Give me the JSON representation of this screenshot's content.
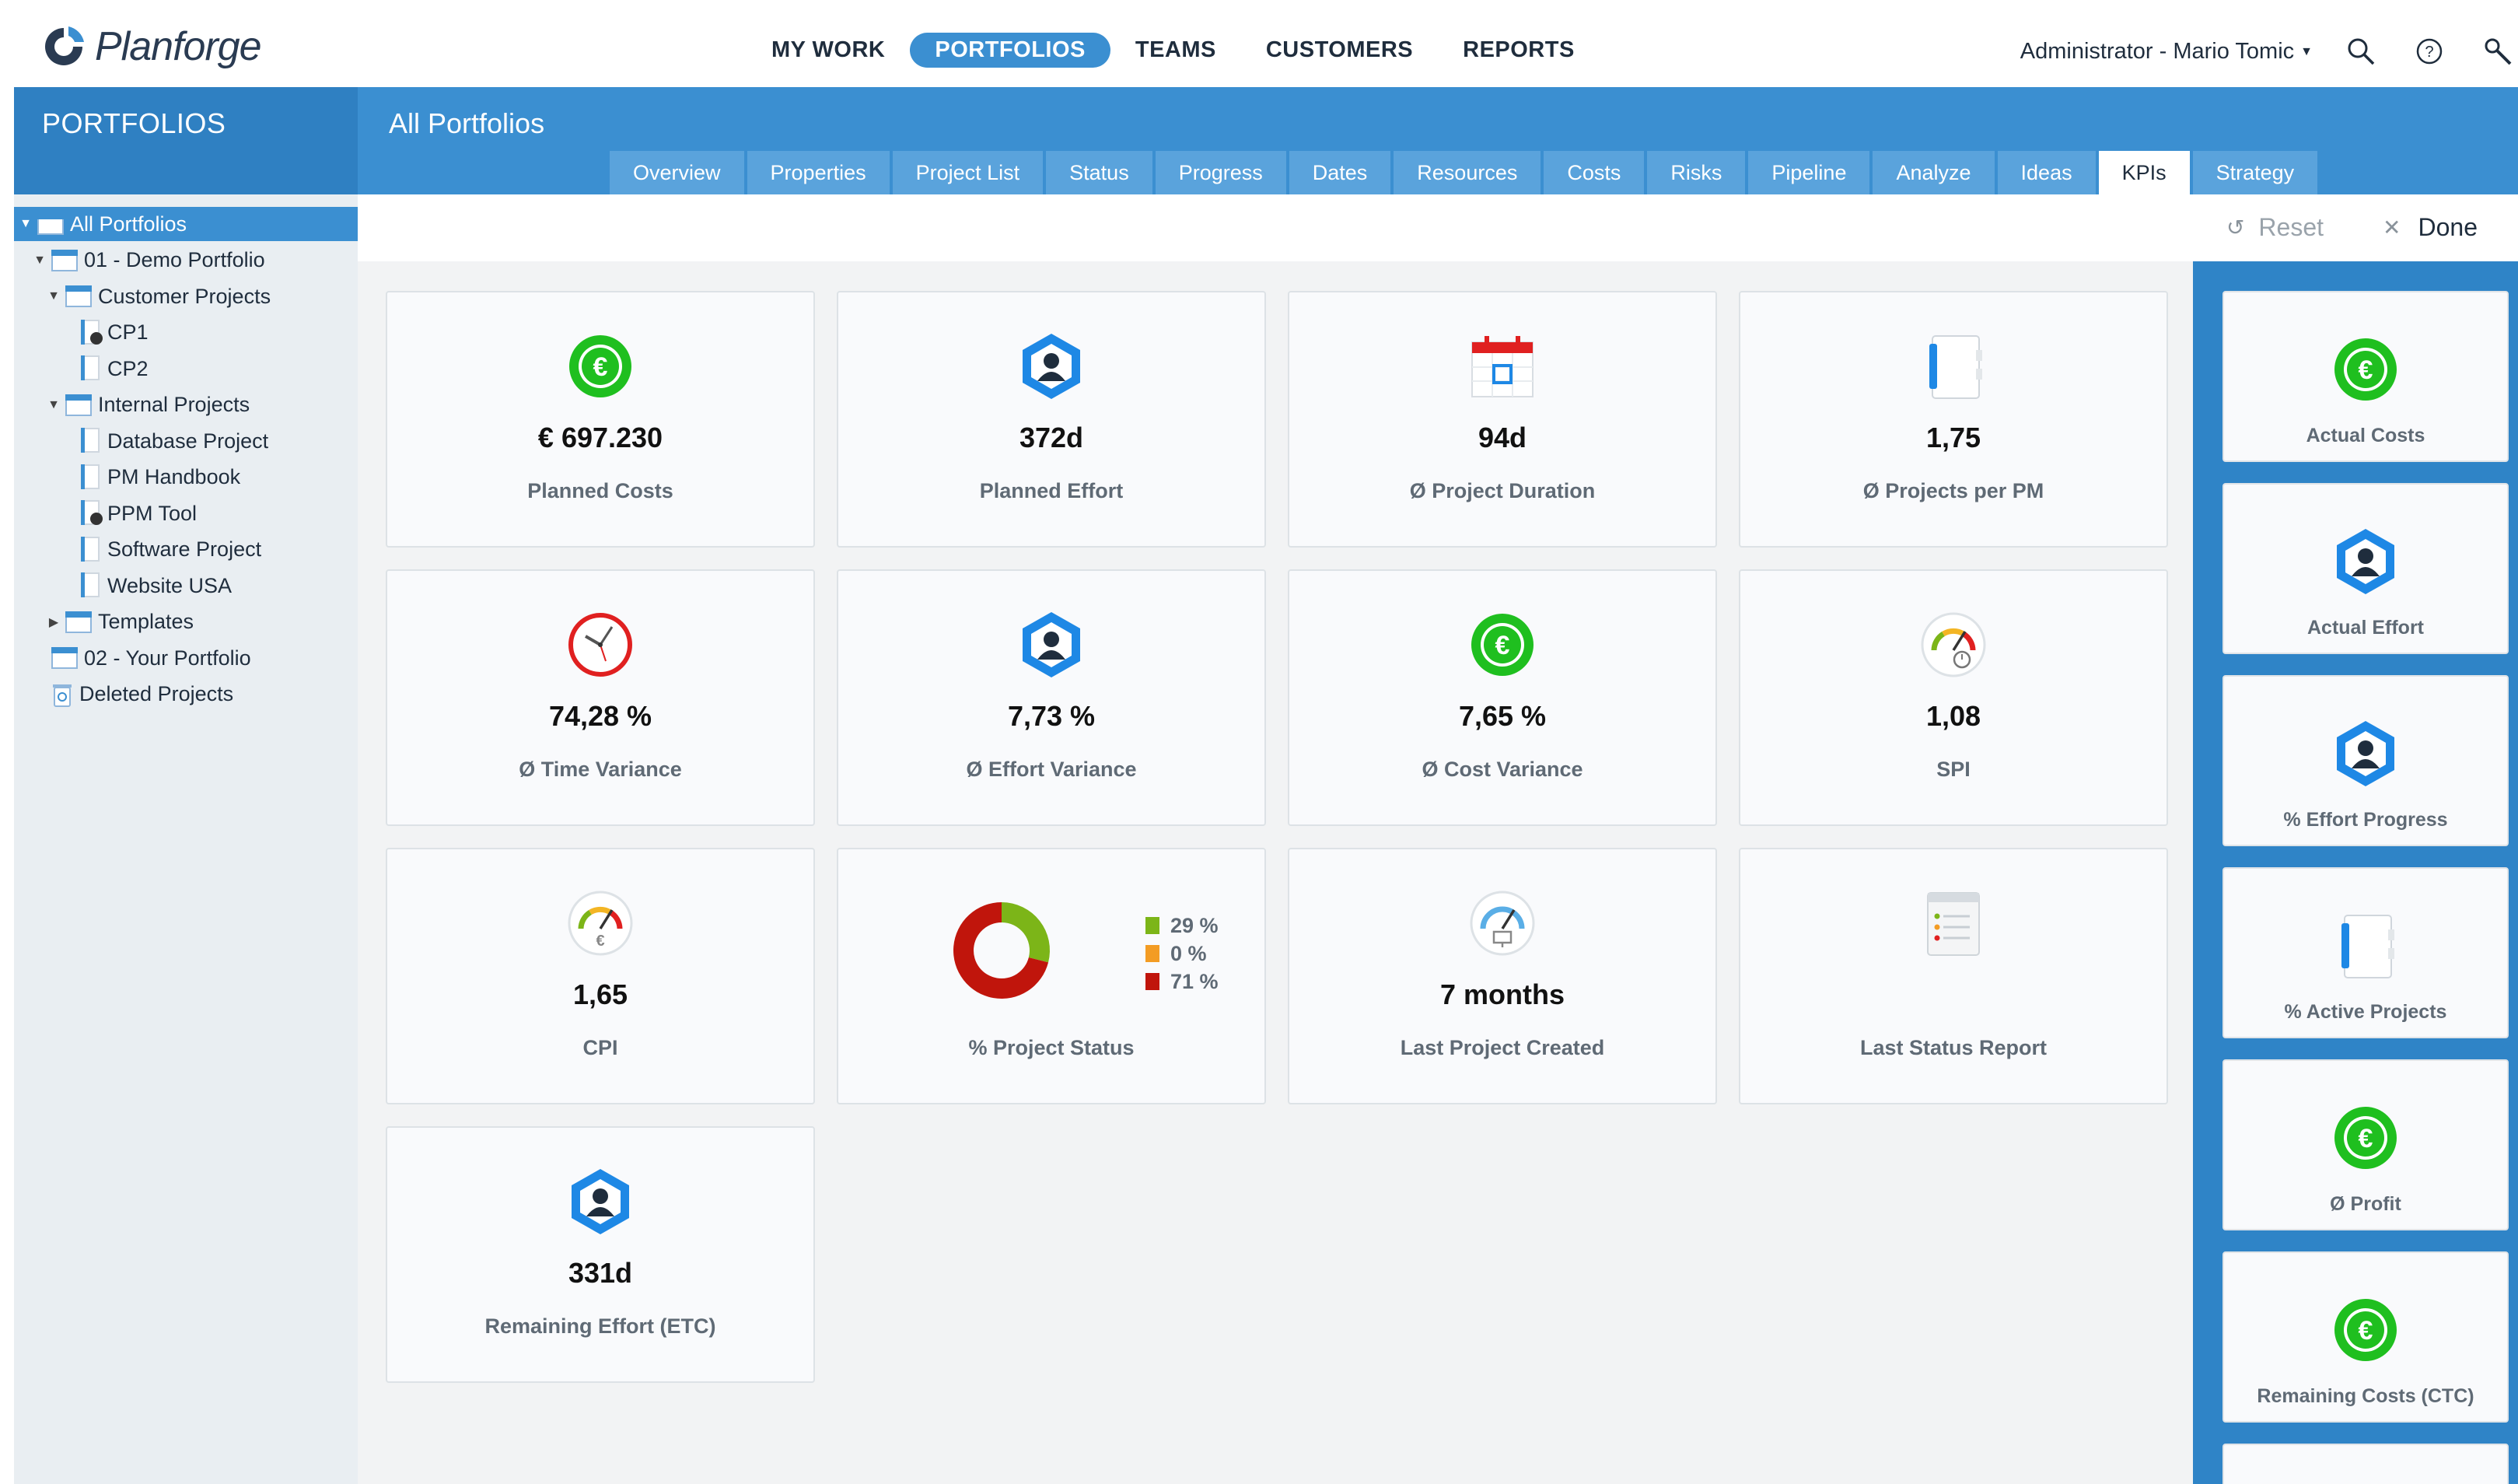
{
  "app": {
    "logo_text": "Planforge"
  },
  "nav": {
    "items": [
      "MY WORK",
      "PORTFOLIOS",
      "TEAMS",
      "CUSTOMERS",
      "REPORTS"
    ],
    "active": "PORTFOLIOS"
  },
  "user": {
    "name": "Administrator - Mario Tomic"
  },
  "section": {
    "title": "PORTFOLIOS"
  },
  "page": {
    "title": "All Portfolios"
  },
  "tabs": [
    "Overview",
    "Properties",
    "Project List",
    "Status",
    "Progress",
    "Dates",
    "Resources",
    "Costs",
    "Risks",
    "Pipeline",
    "Analyze",
    "Ideas",
    "KPIs",
    "Strategy"
  ],
  "active_tab": "KPIs",
  "tree": [
    {
      "label": "All Portfolios",
      "type": "folder",
      "level": 0,
      "expand": "open",
      "selected": true
    },
    {
      "label": "01 - Demo Portfolio",
      "type": "folder",
      "level": 1,
      "expand": "open"
    },
    {
      "label": "Customer Projects",
      "type": "folder",
      "level": 2,
      "expand": "open"
    },
    {
      "label": "CP1",
      "type": "doc",
      "level": 3,
      "badge": true
    },
    {
      "label": "CP2",
      "type": "doc",
      "level": 3
    },
    {
      "label": "Internal Projects",
      "type": "folder",
      "level": 2,
      "expand": "open"
    },
    {
      "label": "Database Project",
      "type": "doc",
      "level": 3
    },
    {
      "label": "PM Handbook",
      "type": "doc",
      "level": 3
    },
    {
      "label": "PPM Tool",
      "type": "doc",
      "level": 3,
      "badge": true
    },
    {
      "label": "Software Project",
      "type": "doc",
      "level": 3
    },
    {
      "label": "Website USA",
      "type": "doc",
      "level": 3
    },
    {
      "label": "Templates",
      "type": "folder",
      "level": 2,
      "expand": "closed"
    },
    {
      "label": "02 - Your Portfolio",
      "type": "folder",
      "level": 1
    },
    {
      "label": "Deleted Projects",
      "type": "trash",
      "level": 1
    }
  ],
  "actions": {
    "reset": "Reset",
    "done": "Done"
  },
  "kpis": [
    {
      "icon": "euro-icon",
      "value": "€ 697.230",
      "label": "Planned Costs"
    },
    {
      "icon": "person-hex-icon",
      "value": "372d",
      "label": "Planned Effort"
    },
    {
      "icon": "calendar-icon",
      "value": "94d",
      "label": "Ø Project Duration"
    },
    {
      "icon": "notebook-icon",
      "value": "1,75",
      "label": "Ø Projects per PM"
    },
    {
      "icon": "clock-icon",
      "value": "74,28 %",
      "label": "Ø Time Variance"
    },
    {
      "icon": "person-hex-icon",
      "value": "7,73 %",
      "label": "Ø Effort Variance"
    },
    {
      "icon": "euro-icon",
      "value": "7,65 %",
      "label": "Ø Cost Variance"
    },
    {
      "icon": "gauge-clock-icon",
      "value": "1,08",
      "label": "SPI"
    },
    {
      "icon": "gauge-euro-icon",
      "value": "1,65",
      "label": "CPI"
    },
    {
      "icon": "donut",
      "value": "",
      "label": "% Project Status"
    },
    {
      "icon": "gauge-monitor-icon",
      "value": "7 months",
      "label": "Last Project Created"
    },
    {
      "icon": "report-icon",
      "value": "",
      "label": "Last Status Report"
    },
    {
      "icon": "person-hex-icon",
      "value": "331d",
      "label": "Remaining Effort (ETC)"
    }
  ],
  "project_status": {
    "legend": [
      {
        "label": "29 %",
        "color": "#7cb518"
      },
      {
        "label": "0 %",
        "color": "#f39c24"
      },
      {
        "label": "71 %",
        "color": "#c0150c"
      }
    ],
    "values": [
      29,
      0,
      71
    ]
  },
  "palette": [
    {
      "icon": "euro-icon",
      "label": "Actual Costs"
    },
    {
      "icon": "person-hex-icon",
      "label": "Actual Effort"
    },
    {
      "icon": "person-hex-icon",
      "label": "% Effort Progress"
    },
    {
      "icon": "notebook-icon",
      "label": "% Active Projects"
    },
    {
      "icon": "euro-icon",
      "label": "Ø Profit"
    },
    {
      "icon": "euro-icon",
      "label": "Remaining Costs (CTC)"
    }
  ],
  "colors": {
    "brand": "#3b8fd1",
    "band": "#2f80c2",
    "palette": "#2f84c7",
    "euro": "#1fbf1f",
    "hex": "#1e88e5",
    "red": "#e02020"
  }
}
